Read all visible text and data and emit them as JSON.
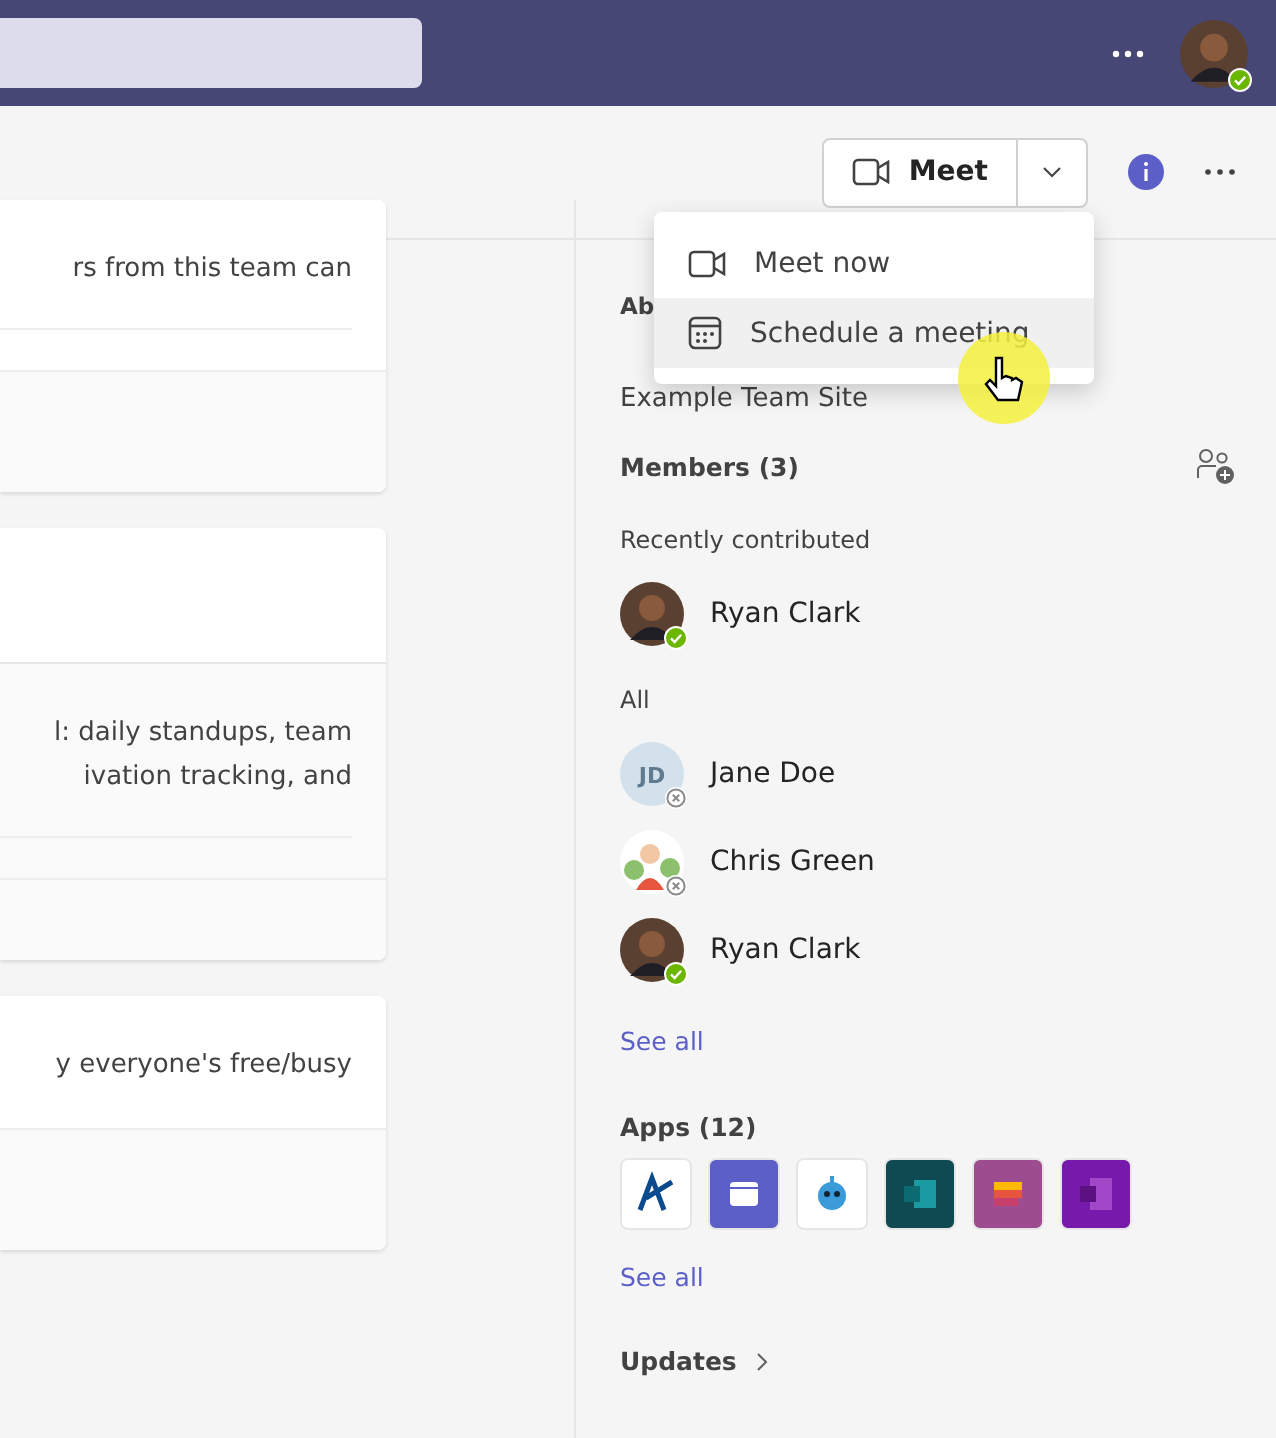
{
  "header": {
    "meet_button": {
      "label": "Meet"
    },
    "menu": {
      "items": [
        {
          "label": "Meet now",
          "kind": "video",
          "selected": false
        },
        {
          "label": "Schedule a meeting",
          "kind": "calendar",
          "selected": true
        }
      ]
    }
  },
  "cards": [
    {
      "lines": [
        "rs from this team can"
      ],
      "header": false
    },
    {
      "lines": [
        "l: daily standups, team",
        "ivation tracking, and"
      ],
      "header": true
    },
    {
      "lines": [
        "y everyone's free/busy"
      ],
      "header": false
    }
  ],
  "about": {
    "heading": "Ab",
    "site": "Example Team Site"
  },
  "members": {
    "heading": "Members (3)",
    "recent_label": "Recently contributed",
    "recent": [
      {
        "name": "Ryan Clark",
        "kind": "photo",
        "available": true
      }
    ],
    "all_label": "All",
    "all": [
      {
        "name": "Jane Doe",
        "kind": "initials",
        "initials": "JD",
        "available": false
      },
      {
        "name": "Chris Green",
        "kind": "illustration",
        "available": false
      },
      {
        "name": "Ryan Clark",
        "kind": "photo",
        "available": true
      }
    ],
    "see_all": "See all"
  },
  "apps": {
    "heading": "Apps (12)",
    "items": [
      {
        "color": "#ffffff"
      },
      {
        "color": "#5b5fc7"
      },
      {
        "color": "#ffffff"
      },
      {
        "color": "#0f4a52"
      },
      {
        "color": "#9c4c8f"
      },
      {
        "color": "#7719aa"
      }
    ],
    "see_all": "See all"
  },
  "updates": {
    "label": "Updates"
  }
}
